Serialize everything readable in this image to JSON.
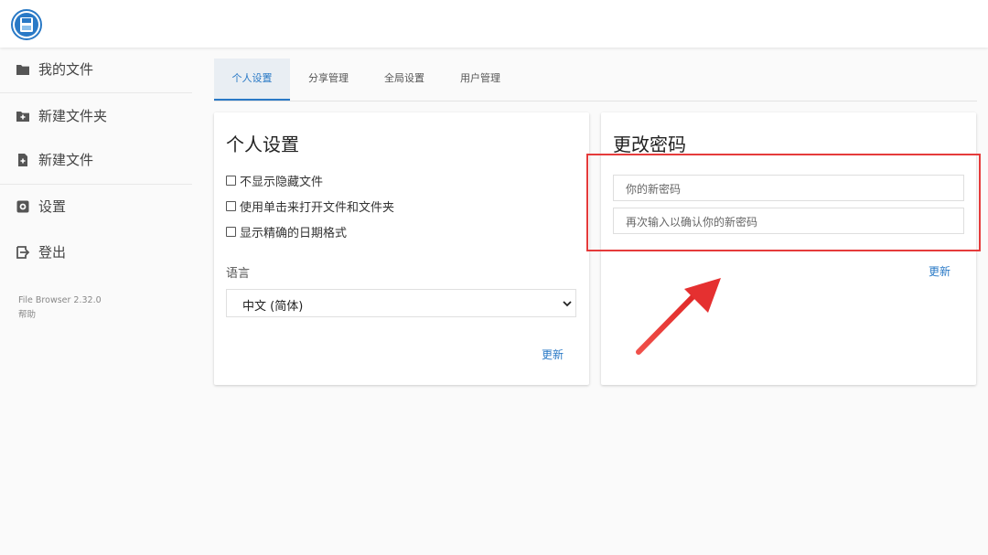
{
  "app": {
    "logo_icon": "floppy-disk-icon"
  },
  "sidebar": {
    "items": [
      {
        "label": "我的文件",
        "icon": "folder-icon"
      },
      {
        "label": "新建文件夹",
        "icon": "folder-plus-icon"
      },
      {
        "label": "新建文件",
        "icon": "file-plus-icon"
      },
      {
        "label": "设置",
        "icon": "gear-icon"
      },
      {
        "label": "登出",
        "icon": "logout-icon"
      }
    ],
    "footer": {
      "version": "File Browser 2.32.0",
      "help": "帮助"
    }
  },
  "tabs": [
    {
      "label": "个人设置",
      "active": true
    },
    {
      "label": "分享管理",
      "active": false
    },
    {
      "label": "全局设置",
      "active": false
    },
    {
      "label": "用户管理",
      "active": false
    }
  ],
  "profile_card": {
    "title": "个人设置",
    "options": [
      {
        "label": "不显示隐藏文件",
        "checked": false
      },
      {
        "label": "使用单击来打开文件和文件夹",
        "checked": false
      },
      {
        "label": "显示精确的日期格式",
        "checked": false
      }
    ],
    "language_label": "语言",
    "language_value": "中文 (简体)",
    "update_label": "更新"
  },
  "password_card": {
    "title": "更改密码",
    "new_password_placeholder": "你的新密码",
    "confirm_password_placeholder": "再次输入以确认你的新密码",
    "update_label": "更新"
  },
  "colors": {
    "accent": "#2979c6",
    "annotation": "#e53b3b"
  }
}
